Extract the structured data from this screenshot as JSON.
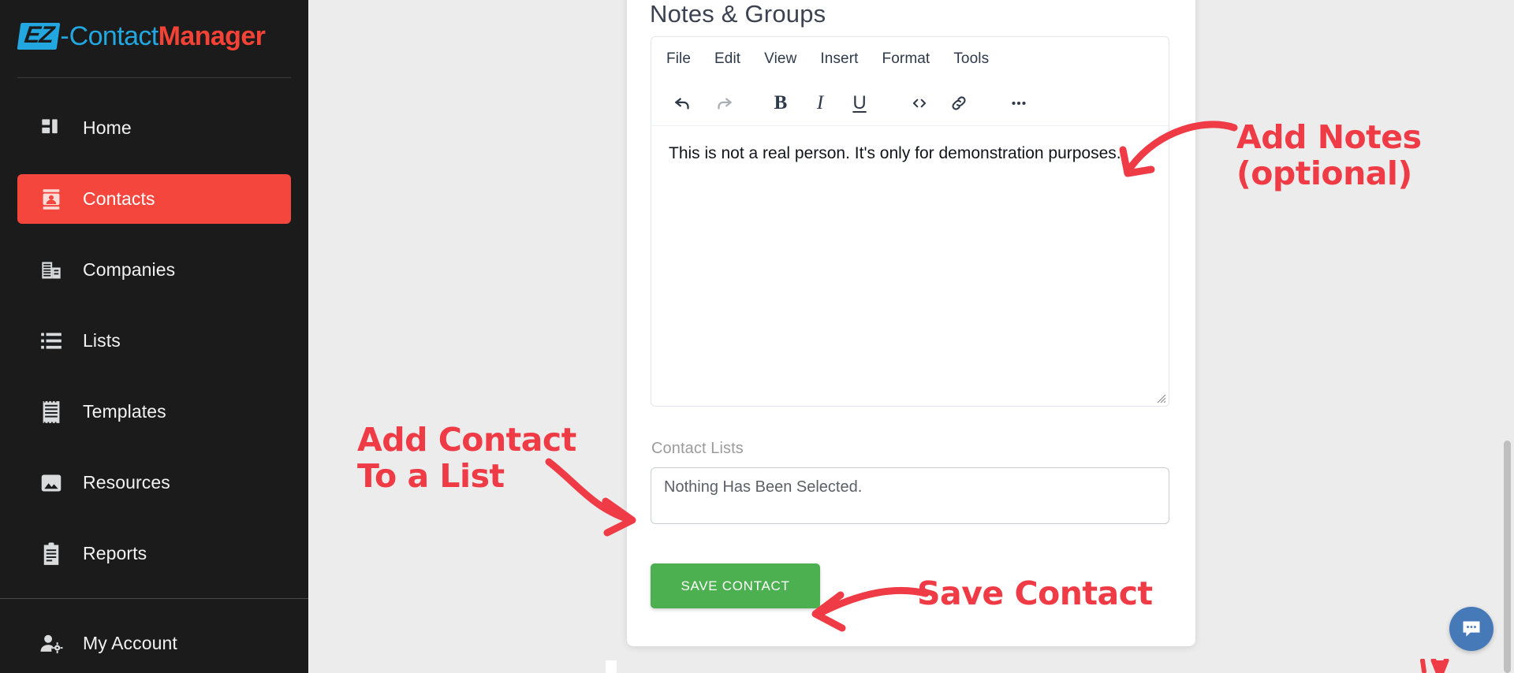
{
  "brand": {
    "mark": "EZ",
    "dash": "-",
    "part1": "Contact",
    "part2": "Manager",
    "accent_blue": "#22a7e0",
    "accent_red": "#f44336"
  },
  "sidebar": {
    "active_color": "#f4463c",
    "background": "#1b1b1b",
    "items": [
      {
        "label": "Home",
        "icon": "dashboard-grid-icon",
        "active": false
      },
      {
        "label": "Contacts",
        "icon": "contact-card-icon",
        "active": true
      },
      {
        "label": "Companies",
        "icon": "office-building-icon",
        "active": false
      },
      {
        "label": "Lists",
        "icon": "bullet-list-icon",
        "active": false
      },
      {
        "label": "Templates",
        "icon": "template-page-icon",
        "active": false
      },
      {
        "label": "Resources",
        "icon": "image-picture-icon",
        "active": false
      },
      {
        "label": "Reports",
        "icon": "clipboard-icon",
        "active": false
      }
    ],
    "account": {
      "label": "My Account",
      "icon": "user-gear-icon"
    }
  },
  "card": {
    "title": "Notes & Groups",
    "editor": {
      "menus": [
        "File",
        "Edit",
        "View",
        "Insert",
        "Format",
        "Tools"
      ],
      "toolbar": [
        {
          "name": "undo-icon",
          "label": "Undo",
          "enabled": true
        },
        {
          "name": "redo-icon",
          "label": "Redo",
          "enabled": false
        },
        {
          "name": "bold-icon",
          "label": "Bold",
          "enabled": true
        },
        {
          "name": "italic-icon",
          "label": "Italic",
          "enabled": true
        },
        {
          "name": "underline-icon",
          "label": "Underline",
          "enabled": true
        },
        {
          "name": "code-icon",
          "label": "Source code",
          "enabled": true
        },
        {
          "name": "link-icon",
          "label": "Insert link",
          "enabled": true
        },
        {
          "name": "more-icon",
          "label": "More",
          "enabled": true
        }
      ],
      "content": "This is not a real person.  It's only for demonstration purposes."
    },
    "contact_lists": {
      "label": "Contact Lists",
      "value": "Nothing Has Been Selected.",
      "placeholder": "Nothing Has Been Selected."
    },
    "save_button": {
      "label": "SAVE CONTACT",
      "color": "#4caf50"
    }
  },
  "annotations": {
    "color": "#ef3b45",
    "notes": "Add Notes\n(optional)",
    "list": "Add Contact\nTo a List",
    "save": "Save Contact"
  },
  "chat": {
    "icon": "chat-bubble-icon",
    "color": "#4579b8"
  },
  "scrollbar": {
    "thumb_color": "#bfbfbf"
  }
}
